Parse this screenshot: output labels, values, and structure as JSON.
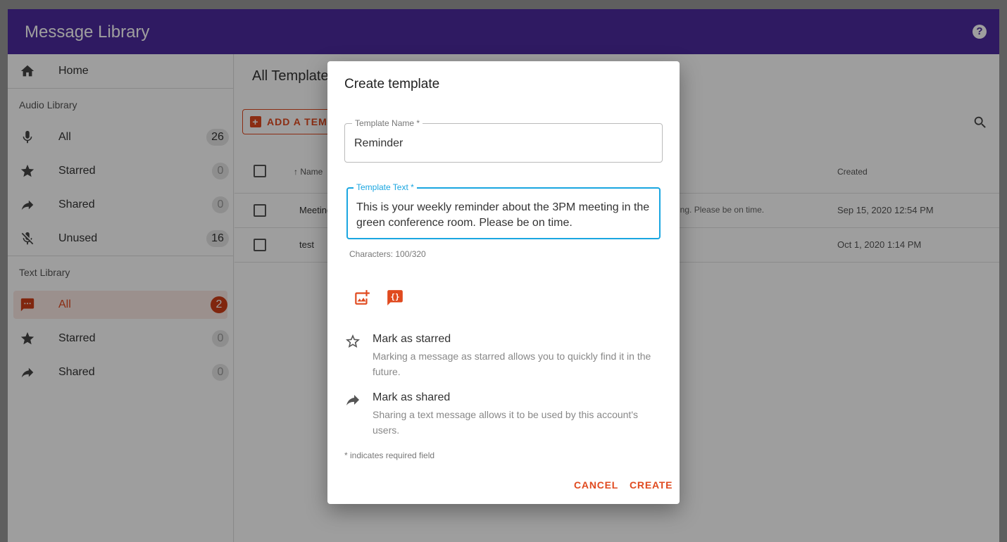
{
  "app": {
    "title": "Message Library",
    "accent": "#4c2a9e",
    "brand_color": "#e04a1f"
  },
  "sidebar": {
    "home_label": "Home",
    "audio_section": "Audio Library",
    "audio_items": [
      {
        "label": "All",
        "count": "26"
      },
      {
        "label": "Starred",
        "count": "0"
      },
      {
        "label": "Shared",
        "count": "0"
      },
      {
        "label": "Unused",
        "count": "16"
      }
    ],
    "text_section": "Text Library",
    "text_items": [
      {
        "label": "All",
        "count": "2"
      },
      {
        "label": "Starred",
        "count": "0"
      },
      {
        "label": "Shared",
        "count": "0"
      }
    ]
  },
  "main": {
    "title": "All Templates",
    "add_button": "ADD A TEMPLATE",
    "columns": {
      "name": "Name",
      "created": "Created"
    },
    "rows": [
      {
        "name": "Meeting",
        "text": "eting. Please be on time.",
        "created": "Sep 15, 2020 12:54 PM"
      },
      {
        "name": "test",
        "text": "",
        "created": "Oct 1, 2020 1:14 PM"
      }
    ]
  },
  "dialog": {
    "title": "Create template",
    "name_label": "Template Name *",
    "name_value": "Reminder",
    "text_label": "Template Text *",
    "text_value": "This is your weekly reminder about the 3PM meeting in the green conference room. Please be on time.",
    "char_count": "Characters: 100/320",
    "starred_title": "Mark as starred",
    "starred_desc": "Marking a message as starred allows you to quickly find it in the future.",
    "shared_title": "Mark as shared",
    "shared_desc": "Sharing a text message allows it to be used by this account's users.",
    "required_note": "* indicates required field",
    "cancel_label": "CANCEL",
    "create_label": "CREATE"
  }
}
